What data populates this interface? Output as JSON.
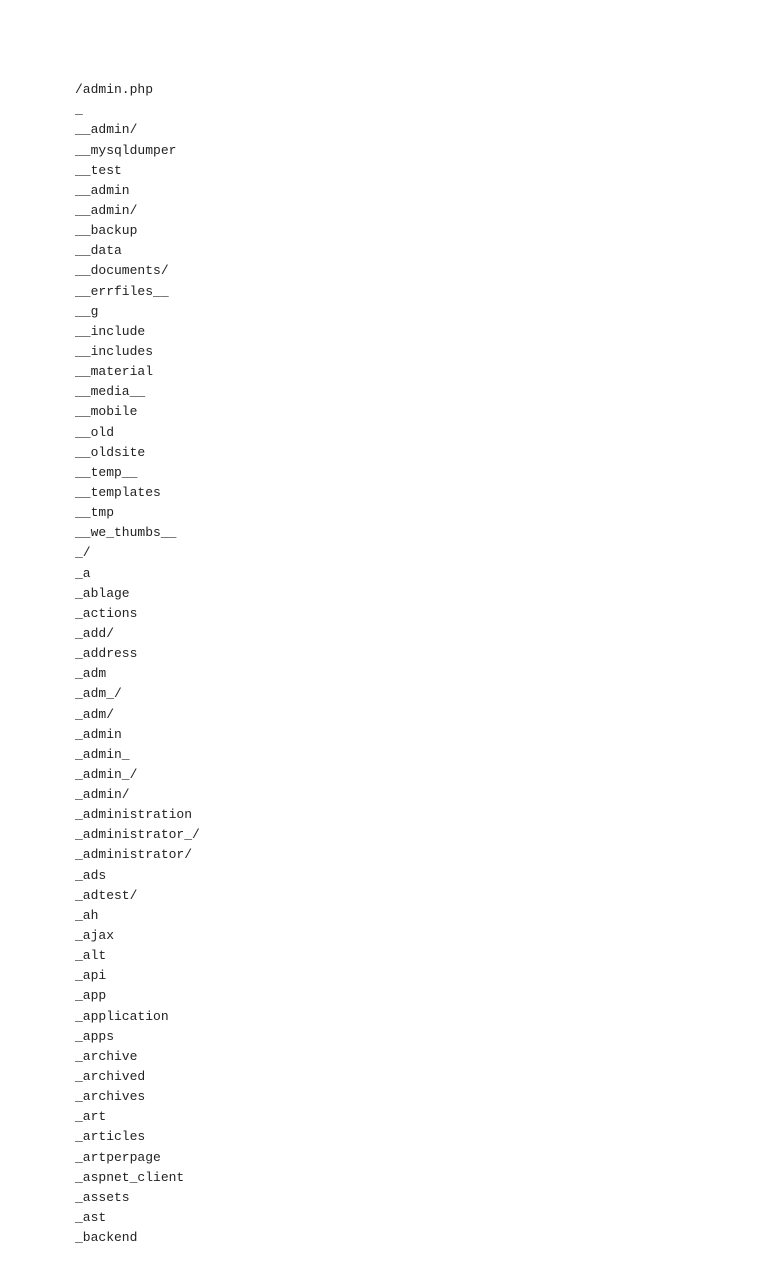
{
  "lines": [
    "/admin.php",
    "_",
    "__admin/",
    "__mysqldumper",
    "__test",
    "__admin",
    "__admin/",
    "__backup",
    "__data",
    "__documents/",
    "__errfiles__",
    "__g",
    "__include",
    "__includes",
    "__material",
    "__media__",
    "__mobile",
    "__old",
    "__oldsite",
    "__temp__",
    "__templates",
    "__tmp",
    "__we_thumbs__",
    "_/",
    "_a",
    "_ablage",
    "_actions",
    "_add/",
    "_address",
    "_adm",
    "_adm_/",
    "_adm/",
    "_admin",
    "_admin_",
    "_admin_/",
    "_admin/",
    "_administration",
    "_administrator_/",
    "_administrator/",
    "_ads",
    "_adtest/",
    "_ah",
    "_ajax",
    "_alt",
    "_api",
    "_app",
    "_application",
    "_apps",
    "_archive",
    "_archived",
    "_archives",
    "_art",
    "_articles",
    "_artperpage",
    "_aspnet_client",
    "_assets",
    "_ast",
    "_backend"
  ]
}
